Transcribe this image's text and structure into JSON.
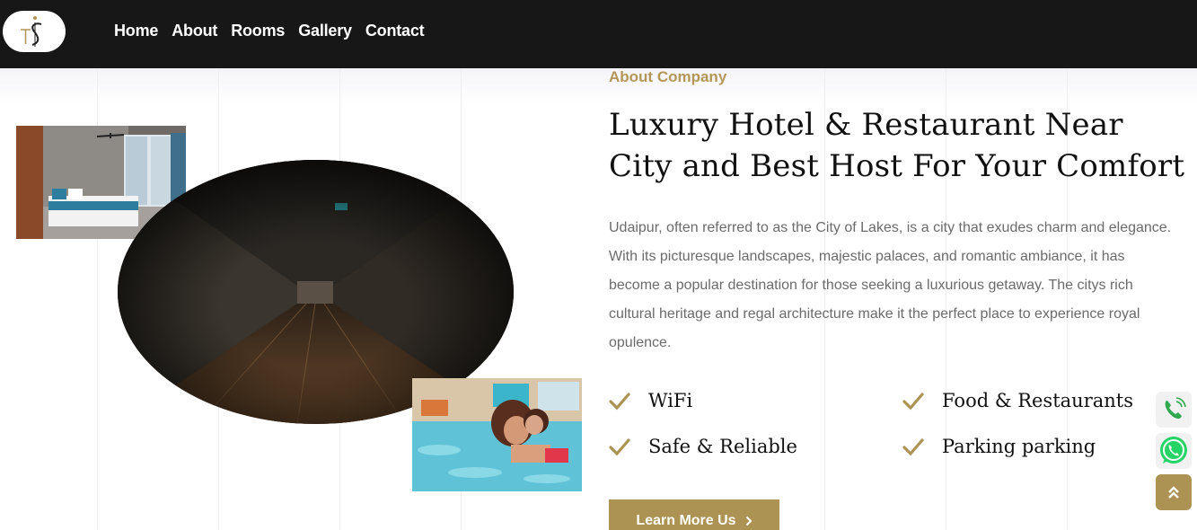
{
  "nav": {
    "logo_alt": "TS",
    "links": [
      "Home",
      "About",
      "Rooms",
      "Gallery",
      "Contact"
    ]
  },
  "about": {
    "subtitle": "About Company",
    "headline": "Luxury Hotel & Restaurant Near City and Best Host For Your Comfort",
    "body": "Udaipur, often referred to as the City of Lakes, is a city that exudes charm and elegance. With its picturesque landscapes, majestic palaces, and romantic ambiance, it has become a popular destination for those seeking a luxurious getaway. The citys rich cultural heritage and regal architecture make it the perfect place to experience royal opulence.",
    "features": [
      "WiFi",
      "Food & Restaurants",
      "Safe & Reliable",
      "Parking parking"
    ],
    "button_label": "Learn More Us"
  },
  "icons": {
    "check": "check-icon",
    "phone": "phone-icon",
    "whatsapp": "whatsapp-icon",
    "scroll_top": "double-chevron-up-icon"
  },
  "colors": {
    "accent": "#ac9353",
    "nav_bg": "#171717",
    "whatsapp": "#25d366",
    "phone": "#2fa84f"
  }
}
